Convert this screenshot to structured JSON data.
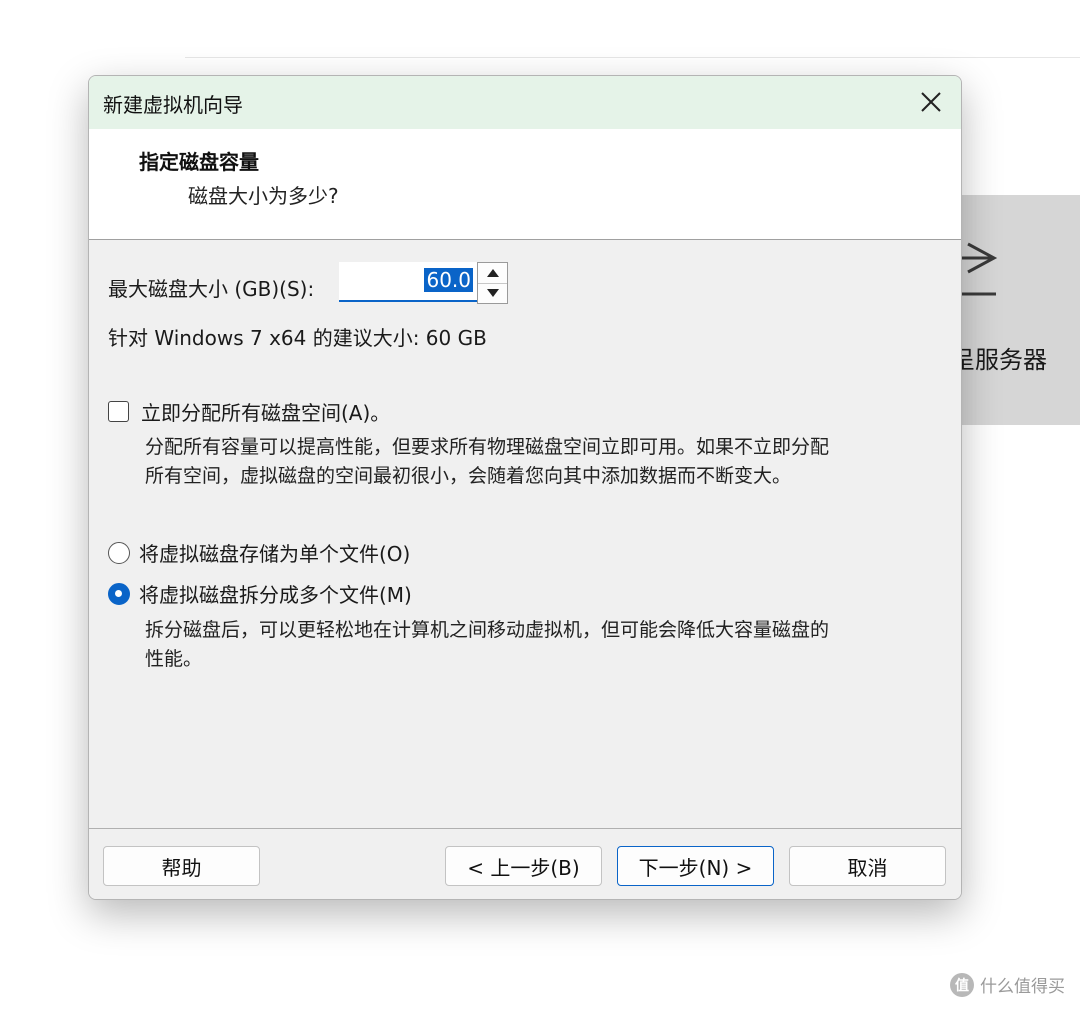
{
  "background": {
    "panel_text": "呈服务器",
    "icon": "arrow-right-bar-icon"
  },
  "dialog": {
    "title": "新建虚拟机向导",
    "close_icon": "close-icon",
    "header": {
      "title": "指定磁盘容量",
      "subtitle": "磁盘大小为多少?"
    },
    "disk_size": {
      "label": "最大磁盘大小 (GB)(S):",
      "value": "60.0"
    },
    "recommendation": "针对 Windows 7 x64 的建议大小: 60 GB",
    "allocate": {
      "label": "立即分配所有磁盘空间(A)。",
      "checked": false,
      "description_line1": "分配所有容量可以提高性能，但要求所有物理磁盘空间立即可用。如果不立即分配",
      "description_line2": "所有空间，虚拟磁盘的空间最初很小，会随着您向其中添加数据而不断变大。"
    },
    "storage_options": [
      {
        "label": "将虚拟磁盘存储为单个文件(O)",
        "checked": false
      },
      {
        "label": "将虚拟磁盘拆分成多个文件(M)",
        "checked": true
      }
    ],
    "split_description_line1": "拆分磁盘后，可以更轻松地在计算机之间移动虚拟机，但可能会降低大容量磁盘的",
    "split_description_line2": "性能。",
    "buttons": {
      "help": "帮助",
      "back": "< 上一步(B)",
      "next": "下一步(N) >",
      "cancel": "取消"
    },
    "accent_color": "#0a64c8",
    "titlebar_color": "#e5f3e8"
  },
  "watermark": {
    "logo": "值",
    "text": "什么值得买"
  }
}
